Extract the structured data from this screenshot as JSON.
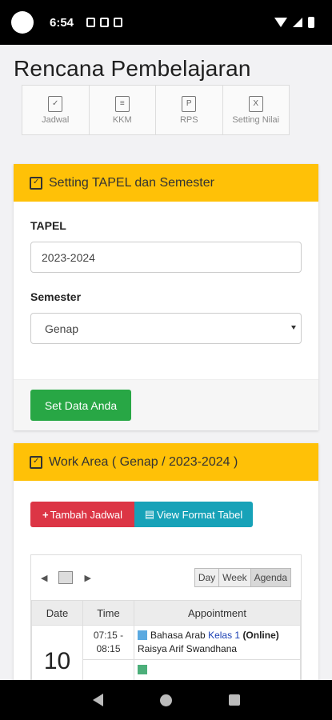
{
  "status": {
    "time": "6:54"
  },
  "page_title": "Rencana Pembelajaran",
  "toolbar": [
    {
      "label": "Jadwal",
      "icon": "calendar-check-icon"
    },
    {
      "label": "KKM",
      "icon": "file-icon"
    },
    {
      "label": "RPS",
      "icon": "file-p-icon"
    },
    {
      "label": "Setting Nilai",
      "icon": "file-excel-icon"
    }
  ],
  "settings": {
    "title": "Setting TAPEL dan Semester",
    "tapel_label": "TAPEL",
    "tapel_value": "2023-2024",
    "semester_label": "Semester",
    "semester_value": "Genap",
    "submit_label": "Set Data Anda"
  },
  "work_area": {
    "title": "Work Area ( Genap / 2023-2024 )",
    "add_label": "Tambah Jadwal",
    "view_label": "View Format Tabel"
  },
  "scheduler": {
    "views": [
      "Day",
      "Week",
      "Agenda"
    ],
    "columns": [
      "Date",
      "Time",
      "Appointment"
    ],
    "date": "10",
    "rows": [
      {
        "time": "07:15 - 08:15",
        "subject": "Bahasa Arab",
        "kelas": "Kelas 1",
        "mode": "(Online)",
        "teacher": "Raisya Arif Swandhana",
        "color": "#5aa9e0"
      },
      {
        "color": "#4caf7a"
      }
    ]
  },
  "colors": {
    "warning": "#ffc107",
    "success": "#28a745",
    "danger": "#dc3545",
    "info": "#17a2b8"
  }
}
